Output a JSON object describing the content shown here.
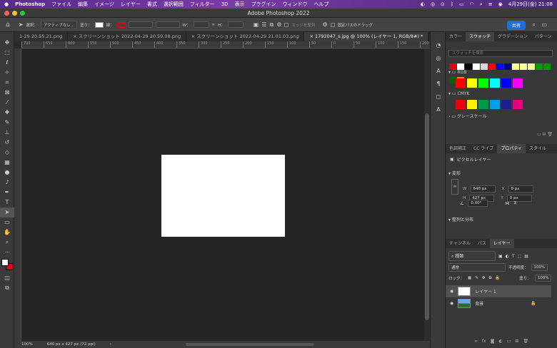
{
  "menubar": {
    "app": "Photoshop",
    "items": [
      "ファイル",
      "編集",
      "イメージ",
      "レイヤー",
      "書式",
      "選択範囲",
      "フィルター",
      "3D",
      "表示",
      "プラグイン",
      "ウィンドウ",
      "ヘルプ"
    ],
    "datetime": "4月29日(金)  21:08"
  },
  "window": {
    "title": "Adobe Photoshop 2022"
  },
  "options": {
    "select_label": "選択：",
    "select_value": "アクティブなレ...",
    "fill_label": "塗り：",
    "stroke_label": "線：",
    "w_label": "W：",
    "h_label": "H：",
    "align_edges": "エッジを整列",
    "fixed_path_drag": "固定パスのドラッグ",
    "share": "共有"
  },
  "tabs": [
    {
      "label": "1-29 20.55.21.png"
    },
    {
      "label": "スクリーンショット 2022-04-29 20.59.08.png"
    },
    {
      "label": "スクリーンショット 2022-04-29 21.01.03.png"
    },
    {
      "label": "1792047_s.jpg @ 100% (レイヤー 1, RGB/8#) *"
    }
  ],
  "ruler_ticks": [
    "700",
    "650",
    "600",
    "550",
    "500",
    "450",
    "400",
    "350",
    "300",
    "250",
    "200",
    "150",
    "100",
    "50",
    "0",
    "50",
    "100",
    "150",
    "200",
    "250",
    "300",
    "350",
    "400",
    "450",
    "500",
    "550",
    "600",
    "650",
    "700",
    "750",
    "800",
    "850",
    "900",
    "950",
    "1000"
  ],
  "status": {
    "zoom": "100%",
    "info": "640 px x 427 px (72 ppi)"
  },
  "swatches_panel": {
    "tabs": [
      "カラー",
      "スウォッチ",
      "グラデーション",
      "パターン"
    ],
    "search_placeholder": "スウォッチを検索",
    "top_colors": [
      "#e60012",
      "#ffffff",
      "#000000",
      "#ffffff",
      "#d9d9d9",
      "#ff0000",
      "#0000ff",
      "#000080",
      "#ffff99",
      "#ffff99",
      "#ffff99",
      "#00a000",
      "#009900",
      "#006600",
      "#ff8000"
    ],
    "groups": [
      {
        "name": "RGB",
        "colors": [
          "#ff0000",
          "#ffff00",
          "#00ff00",
          "#00ffff",
          "#0000ff",
          "#ff00ff"
        ]
      },
      {
        "name": "CMYK",
        "colors": [
          "#e60012",
          "#fff100",
          "#009944",
          "#00a0e9",
          "#1d2088",
          "#e4007f"
        ]
      },
      {
        "name": "グレースケール",
        "colors": []
      }
    ]
  },
  "properties_panel": {
    "tabs": [
      "色調補正",
      "CC ライブ",
      "プロパティ",
      "スタイル"
    ],
    "layer_type": "ピクセルレイヤー",
    "transform_label": "変形",
    "w": "640 px",
    "x": "0 px",
    "h": "427 px",
    "y": "0 px",
    "angle": "0.00°",
    "align_label": "整列と分布"
  },
  "layers_panel": {
    "tabs": [
      "チャンネル",
      "パス",
      "レイヤー"
    ],
    "kind_label": "種類",
    "blend_mode": "通常",
    "opacity_label": "不透明度：",
    "opacity": "100%",
    "lock_label": "ロック：",
    "fill_label": "塗り：",
    "fill": "100%",
    "layers": [
      {
        "name": "レイヤー 1",
        "selected": true
      },
      {
        "name": "背景",
        "selected": false
      }
    ]
  }
}
